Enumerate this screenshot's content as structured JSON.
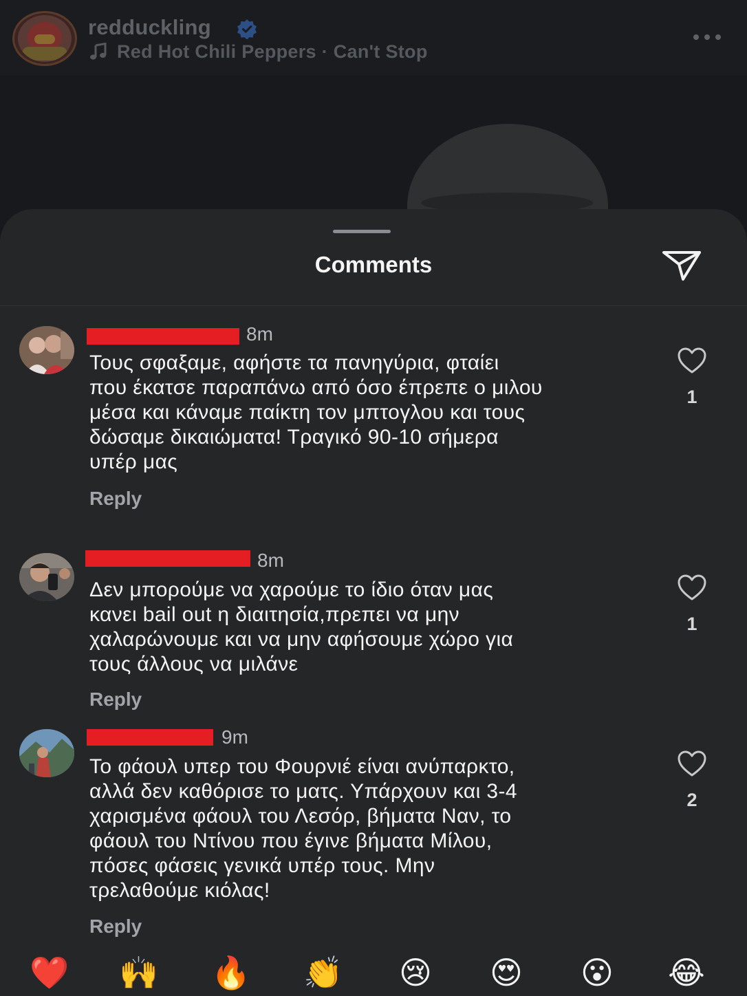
{
  "post": {
    "username": "redduckling",
    "verified": true,
    "music": "Red Hot Chili Peppers · Can't Stop"
  },
  "sheet": {
    "title": "Comments"
  },
  "comments": [
    {
      "time": "8m",
      "text": "Τους σφαξαμε, αφήστε τα πανηγύρια, φταίει που έκατσε παραπάνω από όσο έπρεπε ο μιλου μέσα και κάναμε παίκτη τον μπτογλου και τους δώσαμε δικαιώματα! Τραγικό 90-10 σήμερα υπέρ μας",
      "lines": [
        "Τους σφαξαμε, αφήστε τα πανηγύρια, φταίει",
        "που έκατσε παραπάνω από όσο έπρεπε ο μιλου",
        "μέσα και κάναμε παίκτη τον μπτογλου και τους",
        "δώσαμε δικαιώματα! Τραγικό 90-10 σήμερα",
        "υπέρ μας"
      ],
      "reply_label": "Reply",
      "likes": "1"
    },
    {
      "time": "8m",
      "lines": [
        "Δεν μπορούμε να χαρούμε το ίδιο όταν μας",
        "κανει bail out η διαιτησία,πρεπει να μην",
        "χαλαρώνουμε και να μην αφήσουμε χώρο για",
        "τους άλλους να μιλάνε"
      ],
      "reply_label": "Reply",
      "likes": "1"
    },
    {
      "time": "9m",
      "lines": [
        "Το φάουλ υπερ του Φουρνιέ είναι ανύπαρκτο,",
        "αλλά δεν καθόρισε το ματς. Υπάρχουν και 3-4",
        "χαρισμένα φάουλ του Λεσόρ, βήματα Ναν, το",
        "φάουλ του Ντίνου που έγινε βήματα Μίλου,",
        "πόσες φάσεις γενικά υπέρ τους. Μην",
        "τρελαθούμε κιόλας!"
      ],
      "reply_label": "Reply",
      "likes": "2"
    }
  ],
  "emoji_bar": [
    "❤️",
    "🙌",
    "🔥",
    "👏",
    "😢",
    "😍",
    "😮",
    "😂"
  ],
  "colors": {
    "sheet_bg": "#252628",
    "redaction": "#e41e22",
    "muted_text": "#a3a4a8",
    "verified_blue": "#3b82f6"
  }
}
